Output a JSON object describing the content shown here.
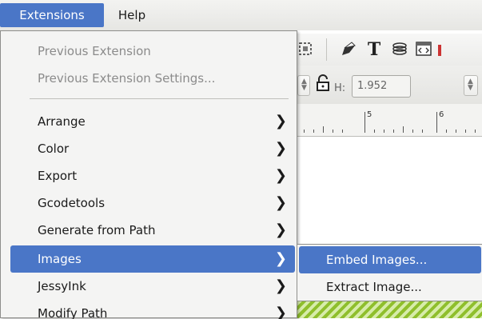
{
  "menubar": {
    "extensions_label": "Extensions",
    "help_label": "Help"
  },
  "toolbar": {
    "h_label": "H:",
    "h_value": "1.952",
    "text_tool_glyph": "T",
    "icons": [
      "node-icon",
      "pen-icon",
      "text-icon",
      "layers-icon",
      "xml-editor-icon"
    ]
  },
  "ruler": {
    "labels": [
      "5",
      "6"
    ]
  },
  "extensions_menu": {
    "items": [
      {
        "label": "Previous Extension",
        "enabled": false
      },
      {
        "label": "Previous Extension Settings...",
        "enabled": false
      },
      {
        "label": "Arrange",
        "submenu": true
      },
      {
        "label": "Color",
        "submenu": true
      },
      {
        "label": "Export",
        "submenu": true
      },
      {
        "label": "Gcodetools",
        "submenu": true
      },
      {
        "label": "Generate from Path",
        "submenu": true
      },
      {
        "label": "Images",
        "submenu": true,
        "active": true
      },
      {
        "label": "JessyInk",
        "submenu": true
      },
      {
        "label": "Modify Path",
        "submenu": true
      }
    ]
  },
  "images_submenu": {
    "items": [
      {
        "label": "Embed Images...",
        "active": true
      },
      {
        "label": "Extract Image..."
      }
    ]
  },
  "colors": {
    "highlight": "#4a76c7",
    "menu_bg": "#f4f4f3",
    "hatch_green": "#8fbf2c"
  }
}
